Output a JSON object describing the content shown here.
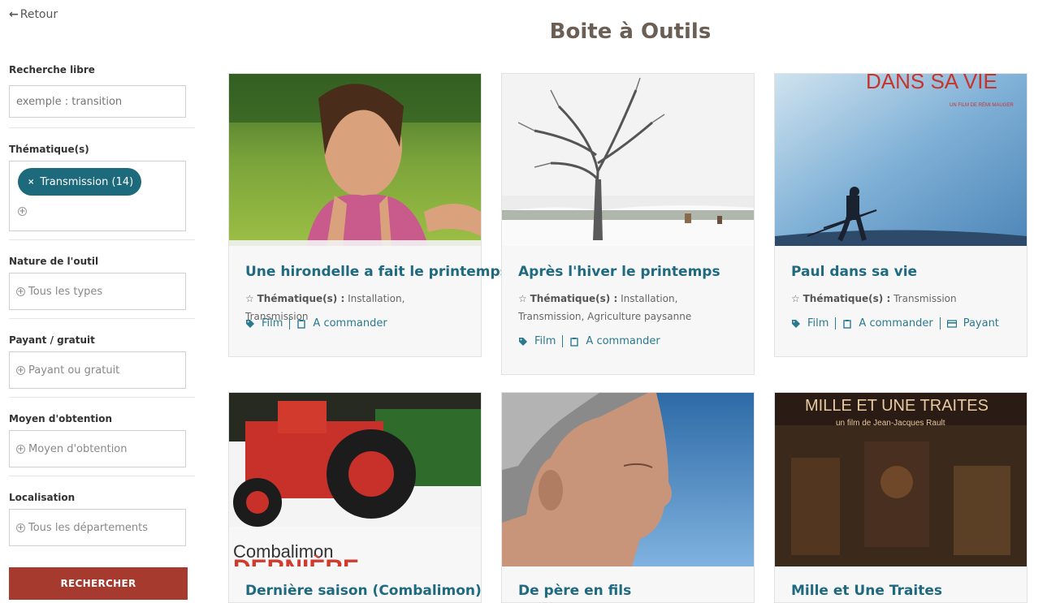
{
  "nav": {
    "back_label": "Retour"
  },
  "page": {
    "title": "Boite à Outils"
  },
  "filters": {
    "search": {
      "label": "Recherche libre",
      "placeholder": "exemple : transition"
    },
    "theme": {
      "label": "Thématique(s)",
      "chip": "Transmission (14)"
    },
    "nature": {
      "label": "Nature de l'outil",
      "value": "Tous les types"
    },
    "payment": {
      "label": "Payant / gratuit",
      "value": "Payant ou gratuit"
    },
    "method": {
      "label": "Moyen d'obtention",
      "value": "Moyen d'obtention"
    },
    "location": {
      "label": "Localisation",
      "value": "Tous les départements"
    },
    "submit_label": "RECHERCHER"
  },
  "cards": [
    {
      "title": "Une hirondelle a fait le printemps",
      "theme_label": "Thématique(s) :",
      "themes": "Installation, Transmission",
      "tags": [
        "Film",
        "A commander"
      ],
      "image": "woman-portrait"
    },
    {
      "title": "Après l'hiver le printemps",
      "theme_label": "Thématique(s) :",
      "themes": "Installation, Transmission, Agriculture paysanne",
      "tags": [
        "Film",
        "A commander"
      ],
      "image": "snowy-tree"
    },
    {
      "title": "Paul dans sa vie",
      "theme_label": "Thématique(s) :",
      "themes": "Transmission",
      "tags": [
        "Film",
        "A commander",
        "Payant"
      ],
      "image": "man-with-scythe",
      "poster_text": "DANS SA VIE",
      "poster_sub": "UN FILM DE RÉMI MAUGER"
    },
    {
      "title": "Dernière saison (Combalimon)",
      "image": "red-tractor",
      "poster_text": "Combalimon",
      "poster_text2": "DERNIÈRE"
    },
    {
      "title": "De père en fils",
      "image": "old-man-profile"
    },
    {
      "title": "Mille et Une Traites",
      "image": "barn-interior",
      "poster_text": "MILLE ET UNE TRAITES",
      "poster_sub": "un film de Jean-Jacques Rault"
    }
  ],
  "colors": {
    "accent": "#1f6a80",
    "button": "#a63a2e",
    "chip": "#1d6a7c"
  }
}
